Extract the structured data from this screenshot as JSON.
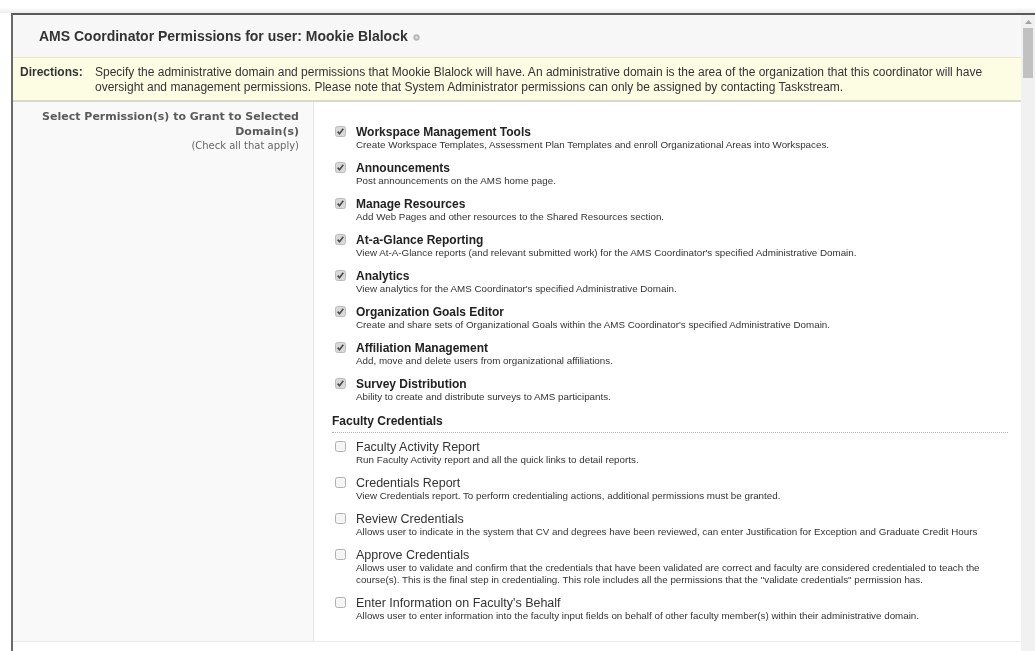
{
  "dialog": {
    "title": "AMS Coordinator Permissions for user: Mookie Blalock"
  },
  "directions": {
    "label": "Directions:",
    "text": "Specify the administrative domain and permissions that Mookie Blalock will have. An administrative domain is the area of the organization that this coordinator will have oversight and management permissions. Please note that System Administrator permissions can only be assigned by contacting Taskstream."
  },
  "permissions_field": {
    "label": "Select Permission(s) to Grant to Selected Domain(s)",
    "hint": "(Check all that apply)"
  },
  "permission_groups": [
    {
      "kind": "core",
      "items": [
        {
          "title": "Workspace Management Tools",
          "description": "Create Workspace Templates, Assessment Plan Templates and enroll Organizational Areas into Workspaces.",
          "checked": true
        },
        {
          "title": "Announcements",
          "description": "Post announcements on the AMS home page.",
          "checked": true
        },
        {
          "title": "Manage Resources",
          "description": "Add Web Pages and other resources to the Shared Resources section.",
          "checked": true
        },
        {
          "title": "At-a-Glance Reporting",
          "description": "View At-A-Glance reports (and relevant submitted work) for the AMS Coordinator's specified Administrative Domain.",
          "checked": true
        },
        {
          "title": "Analytics",
          "description": "View analytics for the AMS Coordinator's specified Administrative Domain.",
          "checked": true
        },
        {
          "title": "Organization Goals Editor",
          "description": "Create and share sets of Organizational Goals within the AMS Coordinator's specified Administrative Domain.",
          "checked": true
        },
        {
          "title": "Affiliation Management",
          "description": "Add, move and delete users from organizational affiliations.",
          "checked": true
        },
        {
          "title": "Survey Distribution",
          "description": "Ability to create and distribute surveys to AMS participants.",
          "checked": true
        }
      ]
    },
    {
      "kind": "credential",
      "heading": "Faculty Credentials",
      "items": [
        {
          "title": "Faculty Activity Report",
          "description": "Run Faculty Activity report and all the quick links to detail reports.",
          "checked": false
        },
        {
          "title": "Credentials Report",
          "description": "View Credentials report. To perform credentialing actions, additional permissions must be granted.",
          "checked": false
        },
        {
          "title": "Review Credentials",
          "description": "Allows user to indicate in the system that CV and degrees have been reviewed, can enter Justification for Exception and Graduate Credit Hours",
          "checked": false
        },
        {
          "title": "Approve Credentials",
          "description": "Allows user to validate and confirm that the credentials that have been validated are correct and faculty are considered credentialed to teach the course(s). This is the final step in credentialing. This role includes all the permissions that the \"validate credentials\" permission has.",
          "checked": false
        },
        {
          "title": "Enter Information on Faculty's Behalf",
          "description": "Allows user to enter information into the faculty input fields on behalf of other faculty member(s) within their administrative domain.",
          "checked": false
        }
      ]
    }
  ]
}
